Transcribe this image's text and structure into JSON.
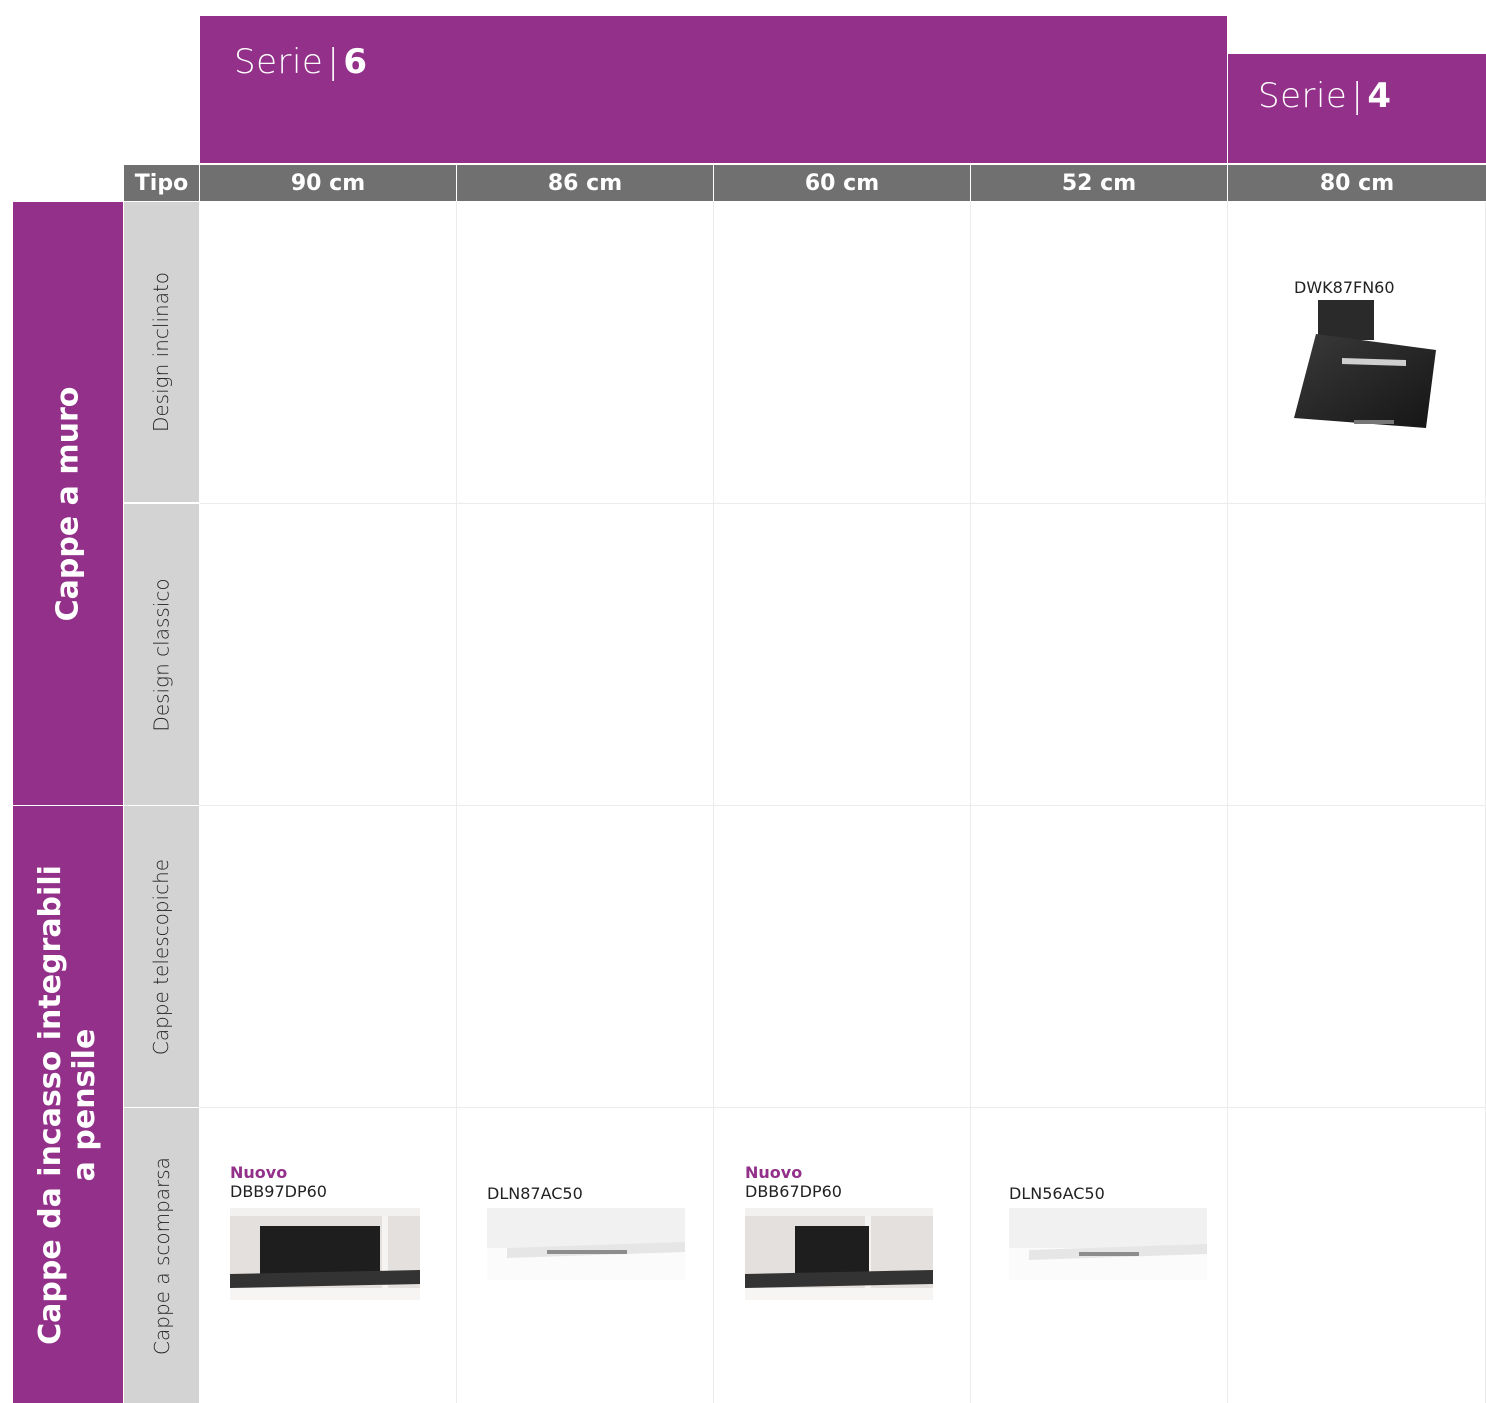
{
  "series": [
    {
      "prefix": "Serie",
      "separator": "|",
      "number": "6"
    },
    {
      "prefix": "Serie",
      "separator": "|",
      "number": "4"
    }
  ],
  "headers": {
    "tipo": "Tipo",
    "widths": [
      "90 cm",
      "86 cm",
      "60 cm",
      "52 cm",
      "80 cm"
    ]
  },
  "groups": [
    {
      "label": "Cappe a muro"
    },
    {
      "label_line1": "Cappe da incasso integrabili",
      "label_line2": "a pensile"
    }
  ],
  "rows": [
    "Design inclinato",
    "Design classico",
    "Cappe telescopiche",
    "Cappe a scomparsa"
  ],
  "products": [
    {
      "code": "DWK87FN60"
    },
    {
      "tag": "Nuovo",
      "code": "DBB97DP60"
    },
    {
      "code": "DLN87AC50"
    },
    {
      "tag": "Nuovo",
      "code": "DBB67DP60"
    },
    {
      "code": "DLN56AC50"
    }
  ]
}
